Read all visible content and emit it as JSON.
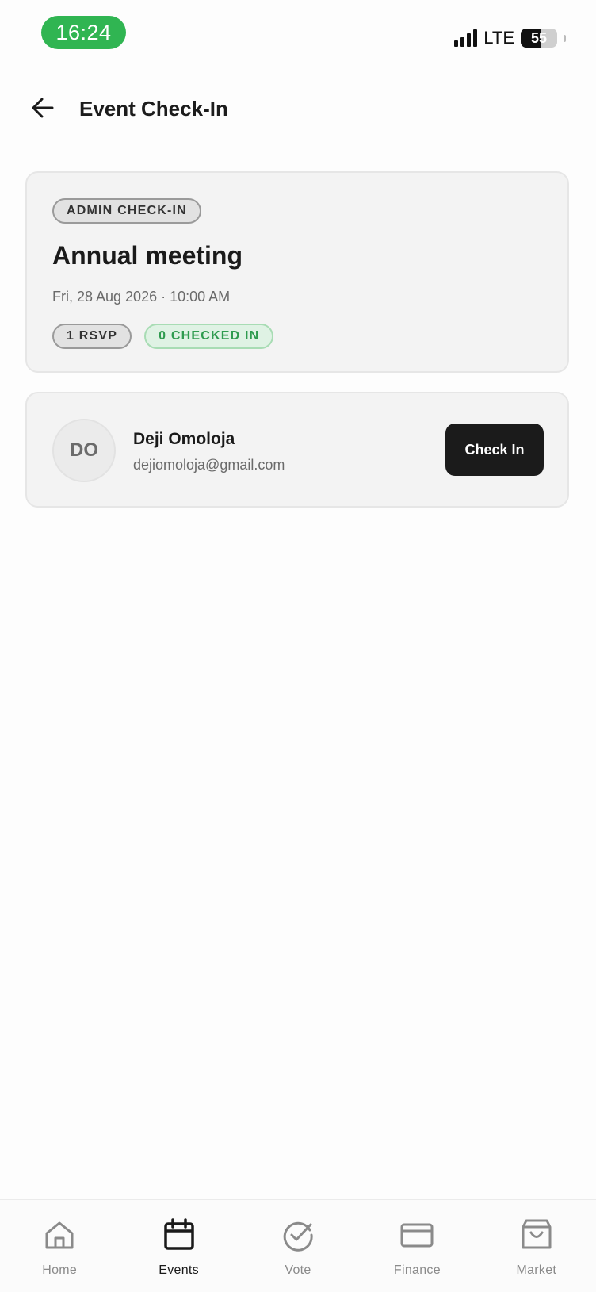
{
  "status_bar": {
    "time": "16:24",
    "network": "LTE",
    "battery": "55",
    "battery_level": 0.55
  },
  "header": {
    "title": "Event Check-In",
    "back_icon": "arrow-left-icon"
  },
  "event": {
    "badge": "ADMIN CHECK-IN",
    "title": "Annual meeting",
    "datetime": "Fri, 28 Aug 2026 · 10:00 AM",
    "rsvp_pill": "1 RSVP",
    "checked_in_pill": "0 CHECKED IN"
  },
  "attendees": [
    {
      "initials": "DO",
      "name": "Deji Omoloja",
      "email": "dejiomoloja@gmail.com",
      "action_label": "Check In"
    }
  ],
  "bottom_nav": {
    "items": [
      {
        "label": "Home",
        "icon": "home-icon",
        "active": false
      },
      {
        "label": "Events",
        "icon": "calendar-icon",
        "active": true
      },
      {
        "label": "Vote",
        "icon": "check-circle-icon",
        "active": false
      },
      {
        "label": "Finance",
        "icon": "card-icon",
        "active": false
      },
      {
        "label": "Market",
        "icon": "shopping-bag-icon",
        "active": false
      }
    ]
  },
  "colors": {
    "status_green": "#30b552",
    "checked_in_green": "#2f9b4f",
    "primary_button": "#1b1b1b",
    "card_background": "#f3f3f3"
  }
}
